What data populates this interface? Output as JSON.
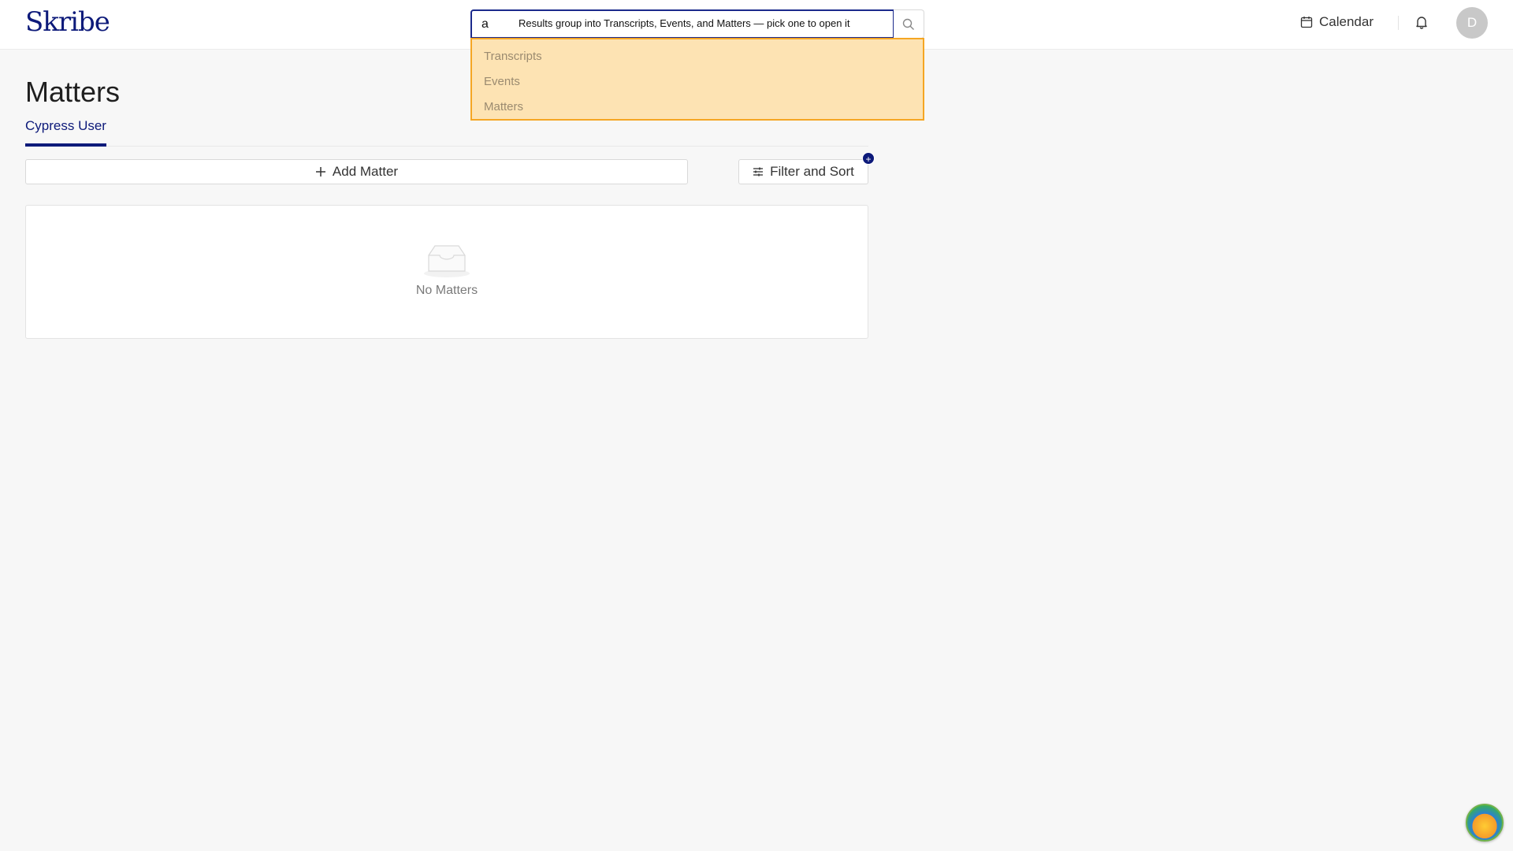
{
  "header": {
    "logo_text": "Skribe",
    "search": {
      "value": "a",
      "hint": "Results group into Transcripts, Events, and Matters — pick one to open it"
    },
    "dropdown_items": [
      "Transcripts",
      "Events",
      "Matters"
    ],
    "calendar_label": "Calendar",
    "avatar_initial": "D"
  },
  "main": {
    "title": "Matters",
    "tabs": [
      {
        "label": "Cypress User",
        "active": true
      }
    ],
    "add_matter_label": "Add Matter",
    "filter_sort_label": "Filter and Sort",
    "filter_badge": "+",
    "empty_text": "No Matters"
  },
  "colors": {
    "brand": "#0d1a7a",
    "dropdown_bg": "#fde3b3",
    "dropdown_border": "#f5a623"
  }
}
